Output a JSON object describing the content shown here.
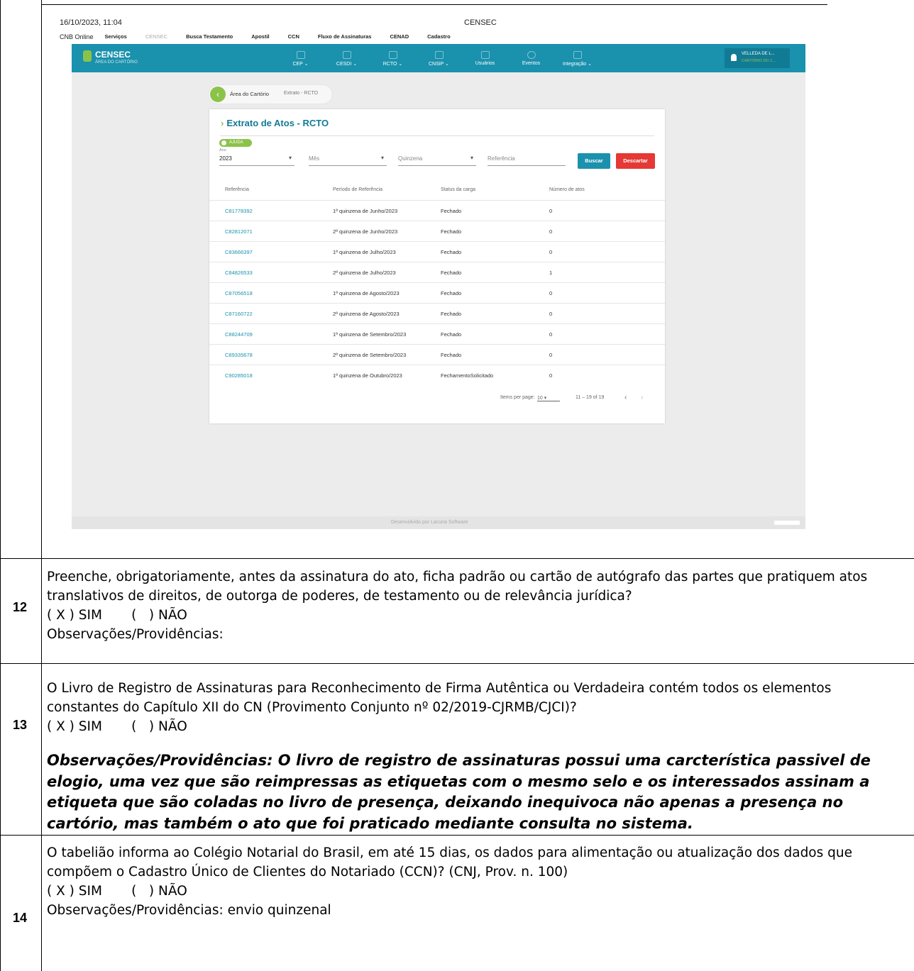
{
  "screenshot": {
    "timestamp": "16/10/2023, 11:04",
    "tab_title": "CENSEC",
    "top_menu": [
      "CNB Online",
      "Serviços",
      "CENSEC",
      "Busca Testamento",
      "Apostil",
      "CCN",
      "Fluxo de Assinaturas",
      "CENAD",
      "Cadastro"
    ],
    "brand": {
      "name": "CENSEC",
      "subtitle": "ÁREA DO CARTÓRIO"
    },
    "nav": [
      "CEP",
      "CESDI",
      "RCTO",
      "CNSIP",
      "Usuários",
      "Eventos",
      "Integração"
    ],
    "user": {
      "name": "VELLEDA DE L...",
      "office": "CARTÓRIO DO 1..."
    },
    "breadcrumb": {
      "home": "Área do Cartório",
      "current": "Extrato - RCTO"
    },
    "card_title": "Extrato de Atos - RCTO",
    "help_label": "AJUDA",
    "filters": {
      "ano_label": "Ano",
      "ano_value": "2023",
      "mes_placeholder": "Mês",
      "quinzena_placeholder": "Quinzena",
      "referencia_placeholder": "Referência"
    },
    "buttons": {
      "search": "Buscar",
      "discard": "Descartar"
    },
    "colors": {
      "primary": "#1a91ad",
      "accent": "#8bc34a",
      "danger": "#e53935"
    },
    "table": {
      "headers": [
        "Referência",
        "Período de Referência",
        "Status da carga",
        "Número de atos"
      ],
      "rows": [
        [
          "C81778392",
          "1ª quinzena de Junho/2023",
          "Fechado",
          "0"
        ],
        [
          "C82812071",
          "2ª quinzena de Junho/2023",
          "Fechado",
          "0"
        ],
        [
          "C83666397",
          "1ª quinzena de Julho/2023",
          "Fechado",
          "0"
        ],
        [
          "C84826533",
          "2ª quinzena de Julho/2023",
          "Fechado",
          "1"
        ],
        [
          "C87056518",
          "1ª quinzena de Agosto/2023",
          "Fechado",
          "0"
        ],
        [
          "C87160722",
          "2ª quinzena de Agosto/2023",
          "Fechado",
          "0"
        ],
        [
          "C88244709",
          "1ª quinzena de Setembro/2023",
          "Fechado",
          "0"
        ],
        [
          "C89335678",
          "2ª quinzena de Setembro/2023",
          "Fechado",
          "0"
        ],
        [
          "C90285018",
          "1ª quinzena de Outubro/2023",
          "FechamentoSolicitado",
          "0"
        ]
      ]
    },
    "pager": {
      "label": "Items per page:",
      "per_page": "10",
      "range": "11 – 19 of 19"
    },
    "footer": "Desenvolvido por Lacuna Software"
  },
  "questions": [
    {
      "number": "12",
      "lines": [
        "Preenche, obrigatoriamente, antes da assinatura do ato, ficha padrão ou cartão de autógrafo das partes que pratiquem atos",
        "translativos de direitos, de outorga de poderes, de testamento ou de relevância jurídica?"
      ],
      "answer": "( X ) SIM       (   ) NÃO",
      "obs": "Observações/Providências:"
    },
    {
      "number": "13",
      "lines": [
        "O Livro de Registro de Assinaturas para Reconhecimento de Firma Autêntica ou Verdadeira contém todos os elementos",
        "constantes do Capítulo XII do CN (Provimento Conjunto nº 02/2019-CJRMB/CJCI)?"
      ],
      "answer": "( X ) SIM       (   ) NÃO",
      "obs_lines": [
        "Observações/Providências: O livro de registro de assinaturas possui uma carcterística passivel de",
        "elogio, uma vez que são reimpressas as etiquetas com o mesmo selo e os interessados assinam a",
        "etiqueta que são coladas no livro de presença, deixando inequivoca não apenas a presença no",
        "cartório, mas também o ato que foi praticado mediante consulta no sistema."
      ]
    },
    {
      "number": "14",
      "lines": [
        "O tabelião informa ao Colégio Notarial do Brasil, em até 15 dias, os dados para alimentação ou atualização dos dados que",
        "compõem o Cadastro Único de Clientes do Notariado (CCN)? (CNJ, Prov. n. 100)"
      ],
      "answer": "( X ) SIM       (   ) NÃO",
      "obs": "Observações/Providências: envio quinzenal"
    }
  ]
}
